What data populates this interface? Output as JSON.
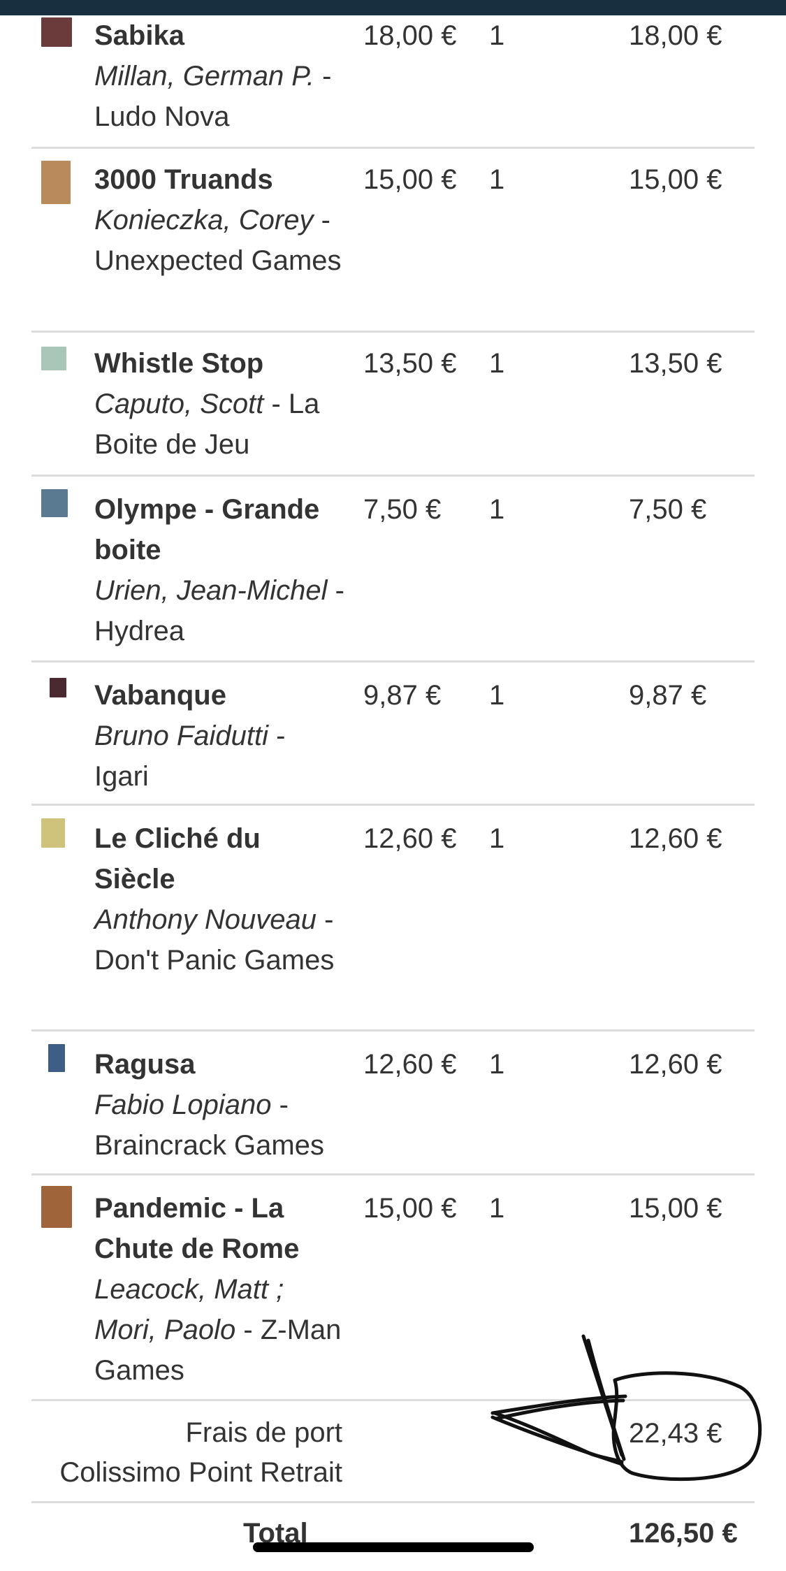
{
  "items": [
    {
      "title": "Sabika",
      "author": "Millan, German P.",
      "publisher": "Ludo Nova",
      "price": "18,00 €",
      "qty": "1",
      "subtotal": "18,00 €",
      "thumb_color": "#6b3a3a"
    },
    {
      "title": "3000 Truands",
      "author": "Konieczka, Corey",
      "publisher": "Unexpected Games",
      "price": "15,00 €",
      "qty": "1",
      "subtotal": "15,00 €",
      "thumb_color": "#b98a5a"
    },
    {
      "title": "Whistle Stop",
      "author": "Caputo, Scott",
      "publisher": "La Boite de Jeu",
      "price": "13,50 €",
      "qty": "1",
      "subtotal": "13,50 €",
      "thumb_color": "#a9c7b9"
    },
    {
      "title": "Olympe - Grande boite",
      "author": "Urien, Jean-Michel",
      "publisher": "Hydrea",
      "price": "7,50 €",
      "qty": "1",
      "subtotal": "7,50 €",
      "thumb_color": "#5a7a92"
    },
    {
      "title": "Vabanque",
      "author": "Bruno Faidutti",
      "publisher": "Igari",
      "price": "9,87 €",
      "qty": "1",
      "subtotal": "9,87 €",
      "thumb_color": "#4a2a30"
    },
    {
      "title": "Le Cliché du Siècle",
      "author": "Anthony Nouveau",
      "publisher": "Don't Panic Games",
      "price": "12,60 €",
      "qty": "1",
      "subtotal": "12,60 €",
      "thumb_color": "#cfc27a"
    },
    {
      "title": "Ragusa",
      "author": "Fabio Lopiano",
      "publisher": "Braincrack Games",
      "price": "12,60 €",
      "qty": "1",
      "subtotal": "12,60 €",
      "thumb_color": "#3f5e86"
    },
    {
      "title": "Pandemic - La Chute de Rome",
      "author": "Leacock, Matt ; Mori, Paolo",
      "publisher": "Z-Man Games",
      "price": "15,00 €",
      "qty": "1",
      "subtotal": "15,00 €",
      "thumb_color": "#a0643a"
    }
  ],
  "shipping": {
    "label_line1": "Frais de port",
    "label_line2": "Colissimo Point Retrait",
    "value": "22,43 €"
  },
  "total": {
    "label": "Total",
    "value": "126,50 €"
  }
}
